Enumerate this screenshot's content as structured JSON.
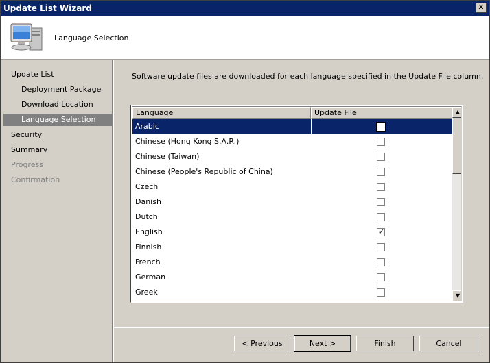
{
  "window": {
    "title": "Update List Wizard",
    "close_label": "✕"
  },
  "header": {
    "title": "Language Selection",
    "icon": "computer-monitor-icon"
  },
  "sidebar": {
    "items": [
      {
        "label": "Update List",
        "level": 1,
        "state": "normal"
      },
      {
        "label": "Deployment Package",
        "level": 2,
        "state": "normal"
      },
      {
        "label": "Download Location",
        "level": 2,
        "state": "normal"
      },
      {
        "label": "Language Selection",
        "level": 2,
        "state": "active"
      },
      {
        "label": "Security",
        "level": 1,
        "state": "normal"
      },
      {
        "label": "Summary",
        "level": 1,
        "state": "normal"
      },
      {
        "label": "Progress",
        "level": 1,
        "state": "disabled"
      },
      {
        "label": "Confirmation",
        "level": 1,
        "state": "disabled"
      }
    ]
  },
  "main": {
    "description": "Software update files are downloaded for each language specified in the Update File column.",
    "columns": {
      "language": "Language",
      "update_file": "Update File"
    },
    "rows": [
      {
        "language": "Arabic",
        "checked": false,
        "selected": true
      },
      {
        "language": "Chinese (Hong Kong S.A.R.)",
        "checked": false,
        "selected": false
      },
      {
        "language": "Chinese (Taiwan)",
        "checked": false,
        "selected": false
      },
      {
        "language": "Chinese (People's Republic of China)",
        "checked": false,
        "selected": false
      },
      {
        "language": "Czech",
        "checked": false,
        "selected": false
      },
      {
        "language": "Danish",
        "checked": false,
        "selected": false
      },
      {
        "language": "Dutch",
        "checked": false,
        "selected": false
      },
      {
        "language": "English",
        "checked": true,
        "selected": false
      },
      {
        "language": "Finnish",
        "checked": false,
        "selected": false
      },
      {
        "language": "French",
        "checked": false,
        "selected": false
      },
      {
        "language": "German",
        "checked": false,
        "selected": false
      },
      {
        "language": "Greek",
        "checked": false,
        "selected": false
      },
      {
        "language": "",
        "checked": false,
        "selected": false
      }
    ],
    "check_mark": "✓"
  },
  "footer": {
    "previous_label": "< Previous",
    "next_label": "Next >",
    "finish_label": "Finish",
    "cancel_label": "Cancel"
  },
  "colors": {
    "selection": "#0a246a",
    "dialog_face": "#d4d0c8"
  }
}
